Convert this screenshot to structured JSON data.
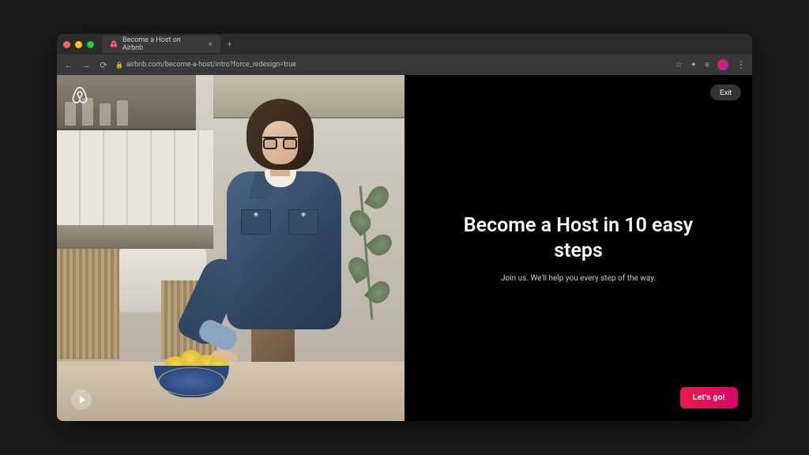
{
  "browser": {
    "tab_title": "Become a Host on Airbnb",
    "url": "airbnb.com/become-a-host/intro?force_redesign=true"
  },
  "page": {
    "exit_label": "Exit",
    "heading": "Become a Host in 10 easy steps",
    "subheading": "Join us. We'll help you every step of the way.",
    "cta_label": "Let's go!"
  },
  "colors": {
    "cta": "#e61e4d",
    "background": "#000000"
  }
}
